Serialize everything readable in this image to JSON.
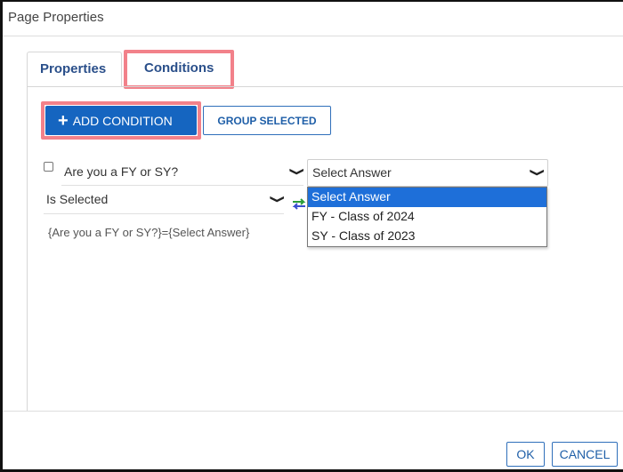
{
  "dialog": {
    "title": "Page Properties"
  },
  "tabs": [
    {
      "label": "Properties",
      "active": false
    },
    {
      "label": "Conditions",
      "active": true
    }
  ],
  "toolbar": {
    "add_icon": "plus-icon",
    "add_label": "ADD CONDITION",
    "group_label": "GROUP SELECTED"
  },
  "condition": {
    "checked": false,
    "question": "Are you a FY or SY?",
    "answer": "Select Answer",
    "operator": "Is Selected",
    "expression": "{Are you a FY or SY?}={Select Answer}",
    "swap_icon": "swap-arrows-icon"
  },
  "answer_dropdown": {
    "options": [
      "Select Answer",
      "FY - Class of 2024",
      "SY - Class of 2023"
    ],
    "highlighted_index": 0
  },
  "footer": {
    "ok_label": "OK",
    "cancel_label": "CANCEL"
  },
  "colors": {
    "primary": "#1565c0",
    "highlight_border": "#f2818a",
    "dropdown_selected": "#1e6fd9",
    "tab_text": "#2a4f8a"
  }
}
